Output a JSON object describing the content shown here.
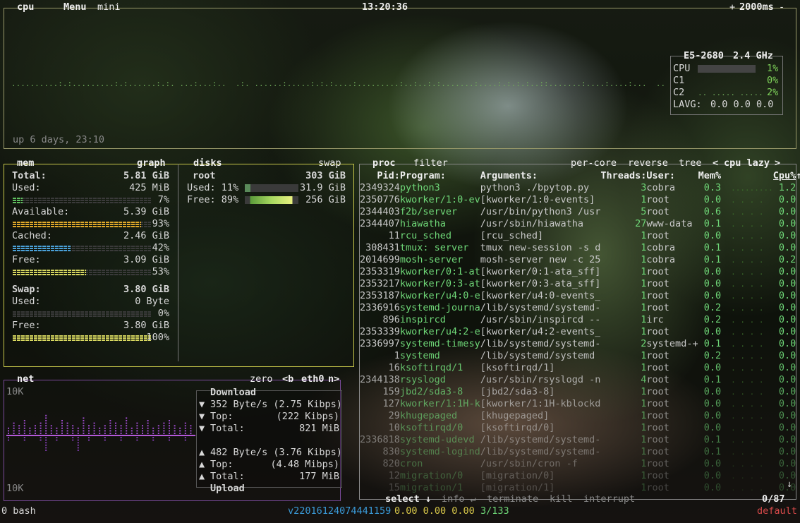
{
  "cpu": {
    "title": "cpu",
    "menu": "Menu",
    "mini": "mini",
    "clock": "13:20:36",
    "rate": "2000ms",
    "plus": "+",
    "minus": "-",
    "uptime": "up 6 days, 23:10",
    "model": "E5-2680",
    "freq": "2.4 GHz",
    "cores": [
      {
        "name": "CPU",
        "pct": "1%"
      },
      {
        "name": "C1",
        "pct": "0%"
      },
      {
        "name": "C2",
        "pct": "2%"
      }
    ],
    "lavg_label": "LAVG:",
    "lavg": "0.0 0.0 0.0"
  },
  "mem": {
    "title": "mem",
    "graph": "graph",
    "total_label": "Total:",
    "total": "5.81 GiB",
    "rows": [
      {
        "label": "Used:",
        "value": "425 MiB",
        "pct": "7%",
        "color": "#5fbf5f",
        "fill": 0.07
      },
      {
        "label": "Available:",
        "value": "5.39 GiB",
        "pct": "93%",
        "color": "#e0a82a",
        "fill": 0.93
      },
      {
        "label": "Cached:",
        "value": "2.46 GiB",
        "pct": "42%",
        "color": "#4aa0d8",
        "fill": 0.42
      },
      {
        "label": "Free:",
        "value": "3.09 GiB",
        "pct": "53%",
        "color": "#d8d860",
        "fill": 0.53
      }
    ],
    "swap_label": "Swap:",
    "swap_total": "3.80 GiB",
    "swap_rows": [
      {
        "label": "Used:",
        "value": "0 Byte",
        "pct": "0%",
        "color": "#5fbf5f",
        "fill": 0
      },
      {
        "label": "Free:",
        "value": "3.80 GiB",
        "pct": "100%",
        "color": "#d8d860",
        "fill": 1.0
      }
    ]
  },
  "disks": {
    "title": "disks",
    "swap": "swap",
    "name": "root",
    "size": "303 GiB",
    "used_label": "Used: 11%",
    "used": "31.9 GiB",
    "used_fill": 0.11,
    "free_label": "Free: 89%",
    "free": "256 GiB",
    "free_fill": 0.89
  },
  "net": {
    "title": "net",
    "zero": "zero",
    "iface_b": "<b",
    "iface": "eth0",
    "iface_n": "n>",
    "scale_top": "10K",
    "scale_bottom": "10K",
    "download": "Download",
    "upload": "Upload",
    "down_rate": "352 Byte/s (2.75 Kibps)",
    "down_top_label": "Top:",
    "down_top": "(222 Kibps)",
    "down_total_label": "Total:",
    "down_total": "821 MiB",
    "up_rate": "482 Byte/s (3.76 Kibps)",
    "up_top_label": "Top:",
    "up_top": "(4.48 Mibps)",
    "up_total_label": "Total:",
    "up_total": "177 MiB"
  },
  "proc": {
    "title": "proc",
    "filter": "filter",
    "per_core": "per-core",
    "reverse": "reverse",
    "tree": "tree",
    "lt": "<",
    "sort": "cpu lazy",
    "gt": ">",
    "headers": {
      "pid": "Pid:",
      "program": "Program:",
      "args": "Arguments:",
      "threads": "Threads:",
      "user": "User:",
      "mem": "Mem%",
      "cpu": "Cpu%"
    },
    "rows": [
      [
        "2349324",
        "python3",
        "python3 ./bpytop.py",
        "3",
        "cobra",
        "0.3",
        "1.2"
      ],
      [
        "2350776",
        "kworker/1:0-ev",
        "[kworker/1:0-events]",
        "1",
        "root",
        "0.0",
        "0.0"
      ],
      [
        "2344403",
        "f2b/server",
        "/usr/bin/python3 /usr",
        "5",
        "root",
        "0.6",
        "0.0"
      ],
      [
        "2344407",
        "hiawatha",
        "/usr/sbin/hiawatha",
        "27",
        "www-data",
        "0.1",
        "0.0"
      ],
      [
        "11",
        "rcu_sched",
        "[rcu_sched]",
        "1",
        "root",
        "0.0",
        "0.0"
      ],
      [
        "308431",
        "tmux: server",
        "tmux new-session -s d",
        "1",
        "cobra",
        "0.1",
        "0.0"
      ],
      [
        "2014699",
        "mosh-server",
        "mosh-server new -c 25",
        "1",
        "cobra",
        "0.1",
        "0.2"
      ],
      [
        "2353319",
        "kworker/0:1-at",
        "[kworker/0:1-ata_sff]",
        "1",
        "root",
        "0.0",
        "0.0"
      ],
      [
        "2353217",
        "kworker/0:3-at",
        "[kworker/0:3-ata_sff]",
        "1",
        "root",
        "0.0",
        "0.0"
      ],
      [
        "2353187",
        "kworker/u4:0-e",
        "[kworker/u4:0-events_",
        "1",
        "root",
        "0.0",
        "0.0"
      ],
      [
        "2336916",
        "systemd-journa",
        "/lib/systemd/systemd-",
        "1",
        "root",
        "0.2",
        "0.0"
      ],
      [
        "896",
        "inspircd",
        "/usr/sbin/inspircd --",
        "1",
        "irc",
        "0.2",
        "0.0"
      ],
      [
        "2353339",
        "kworker/u4:2-e",
        "[kworker/u4:2-events_",
        "1",
        "root",
        "0.0",
        "0.0"
      ],
      [
        "2336997",
        "systemd-timesy",
        "/lib/systemd/systemd-",
        "2",
        "systemd-+",
        "0.1",
        "0.0"
      ],
      [
        "1",
        "systemd",
        "/lib/systemd/systemd",
        "1",
        "root",
        "0.2",
        "0.0"
      ],
      [
        "16",
        "ksoftirqd/1",
        "[ksoftirqd/1]",
        "1",
        "root",
        "0.0",
        "0.0"
      ],
      [
        "2344138",
        "rsyslogd",
        "/usr/sbin/rsyslogd -n",
        "4",
        "root",
        "0.1",
        "0.0"
      ],
      [
        "159",
        "jbd2/sda3-8",
        "[jbd2/sda3-8]",
        "1",
        "root",
        "0.0",
        "0.0"
      ],
      [
        "127",
        "kworker/1:1H-k",
        "[kworker/1:1H-kblockd",
        "1",
        "root",
        "0.0",
        "0.0"
      ],
      [
        "29",
        "khugepaged",
        "[khugepaged]",
        "1",
        "root",
        "0.0",
        "0.0"
      ],
      [
        "10",
        "ksoftirqd/0",
        "[ksoftirqd/0]",
        "1",
        "root",
        "0.0",
        "0.0"
      ],
      [
        "2336818",
        "systemd-udevd",
        "/lib/systemd/systemd-",
        "1",
        "root",
        "0.1",
        "0.0"
      ],
      [
        "830",
        "systemd-logind",
        "/lib/systemd/systemd-",
        "1",
        "root",
        "0.1",
        "0.0"
      ],
      [
        "820",
        "cron",
        "/usr/sbin/cron -f",
        "1",
        "root",
        "0.0",
        "0.0"
      ],
      [
        "12",
        "migration/0",
        "[migration/0]",
        "1",
        "root",
        "0.0",
        "0.0"
      ],
      [
        "15",
        "migration/1",
        "[migration/1]",
        "1",
        "root",
        "0.0",
        "0.0"
      ]
    ],
    "footer": {
      "select": "select",
      "info": "info",
      "terminate": "terminate",
      "kill": "kill",
      "interrupt": "interrupt",
      "count": "0/87"
    }
  },
  "status": {
    "left": "0 bash",
    "version": "v22016124074441159",
    "loads": "0.00 0.00 0.00",
    "procs": "3/133",
    "right": "default"
  },
  "colors": {
    "cpu_border": "#8a8a5a",
    "mem_border": "#c8c84a",
    "net_border": "#6a3a8a",
    "proc_border": "#8a8a8a",
    "accent": "#7fd35a"
  }
}
